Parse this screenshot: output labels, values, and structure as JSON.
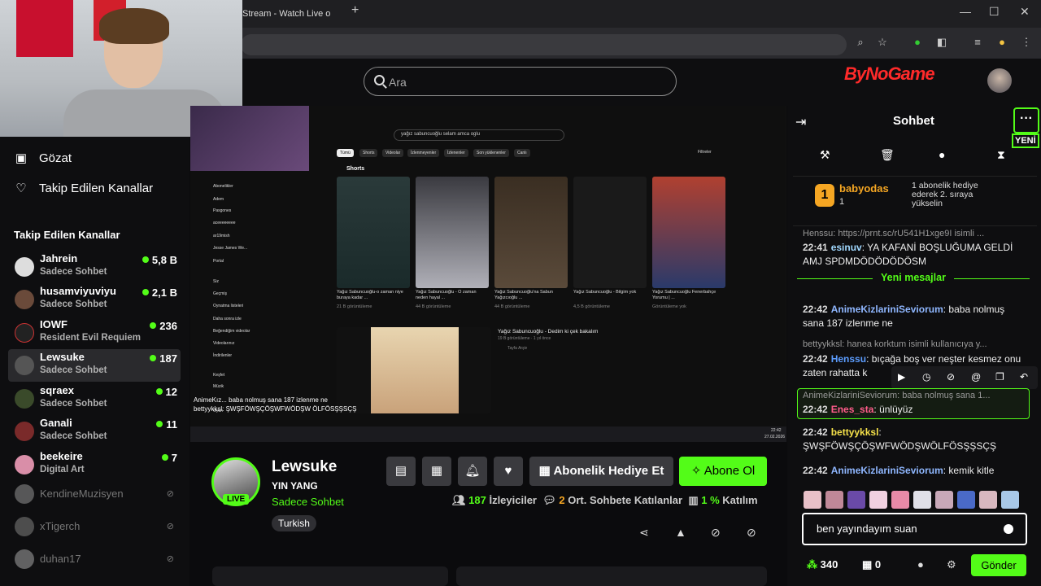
{
  "browser": {
    "tab_title": "Stream - Watch Live o",
    "new_tab": "+"
  },
  "site": {
    "search_placeholder": "Ara",
    "logo_text": "ByNoGame"
  },
  "sidebar": {
    "browse": "Gözat",
    "following_channels": "Takip Edilen Kanallar",
    "followed_header": "Takip Edilen Kanallar",
    "channels": [
      {
        "name": "Jahrein",
        "category": "Sadece Sohbet",
        "viewers": "5,8 B"
      },
      {
        "name": "husamviyuviyu",
        "category": "Sadece Sohbet",
        "viewers": "2,1 B"
      },
      {
        "name": "IOWF",
        "category": "Resident Evil Requiem",
        "viewers": "236"
      },
      {
        "name": "Lewsuke",
        "category": "Sadece Sohbet",
        "viewers": "187"
      },
      {
        "name": "sqraex",
        "category": "Sadece Sohbet",
        "viewers": "12"
      },
      {
        "name": "Ganali",
        "category": "Sadece Sohbet",
        "viewers": "11"
      },
      {
        "name": "beekeire",
        "category": "Digital Art",
        "viewers": "7"
      },
      {
        "name": "KendineMuzisyen"
      },
      {
        "name": "xTigerch"
      },
      {
        "name": "duhan17"
      }
    ]
  },
  "video": {
    "yt_search": "yağız sabuncuoğlu selam amca oglu",
    "chips": [
      "Tümü",
      "Shorts",
      "Videolar",
      "İzlenmeyenler",
      "İzlenenler",
      "Son yüklenenler",
      "Canlı"
    ],
    "filters": "Filtreler",
    "shorts_label": "Shorts",
    "menu": [
      "Abonelikler",
      "Adem",
      "Pasgones",
      "aceeeeeeee",
      "ar19mish",
      "Jesse James We...",
      "Portal",
      "Siz",
      "Geçmiş",
      "Oynatma listeleri",
      "Daha sonra izle",
      "Beğendiğim videolar",
      "Videolarınız",
      "İndirilenler",
      "Keşfet",
      "Müzik",
      "Oyun"
    ],
    "thumbs": [
      {
        "cap": "Yağız Sabuncuoğlu-o zaman niye buraya kadar ...",
        "views": "21 B görüntüleme"
      },
      {
        "cap": "Yağız Sabuncuoğlu - O zaman neden hayal ...",
        "views": "44 B görüntüleme"
      },
      {
        "cap": "Yağız Sabuncuoğlu'na Sabun Yağızcıoğlu ...",
        "views": "44 B görüntüleme"
      },
      {
        "cap": "Yağız Sabuncuoğlu - Bilgim yok",
        "views": "4,5 B görüntüleme"
      },
      {
        "cap": "Yağız Sabuncuoğlu Fenerbahçe Yorumu | ...",
        "views": "Görüntüleme yok"
      }
    ],
    "video_title": "Yağız Sabuncuoğlu - Dedim ki çek bakalım",
    "video_meta": "19 B görüntüleme · 1 yıl önce",
    "video_channel": "Tayfa Arşiv",
    "overlay_chat": [
      "AnimeKız... baba nolmuş sana 187 izlenme ne",
      "bettyykksl: ŞWŞFÖWŞÇÖŞWFWÖDŞW ÖLFÖSŞŞSÇŞ"
    ],
    "clock": "22:42",
    "date": "27.02.2026"
  },
  "channel": {
    "name": "Lewsuke",
    "title": "YIN YANG",
    "category": "Sadece Sohbet",
    "language": "Turkish",
    "live": "LIVE",
    "gift_label": "Abonelik Hediye Et",
    "subscribe_label": "Abone Ol",
    "viewers_num": "187",
    "viewers_label": "İzleyiciler",
    "chatters_num": "2",
    "chatters_label": "Ort. Sohbete Katılanlar",
    "participation_num": "1 %",
    "participation_label": "Katılım"
  },
  "chat": {
    "title": "Sohbet",
    "new_badge": "YENİ",
    "pinned": {
      "user": "babyodas",
      "subs": "1",
      "desc": "1 abonelik hediye ederek 2. sıraya yükselin"
    },
    "messages": [
      {
        "reply": "Henssu: https://prnt.sc/rU541H1xge9I isimli ..."
      },
      {
        "time": "22:41",
        "user": "esinuv",
        "color": "#a0d8ff",
        "text": "YA KAFANİ BOŞLUĞUMA GELDİ AMJ SPDMDÖDÖDÖDÖSM"
      },
      {
        "time": "22:42",
        "user": "AnimeKizlariniSeviorum",
        "color": "#8fb7ff",
        "text": "baba nolmuş sana 187 izlenme ne"
      },
      {
        "reply": "bettyykksl: hanea korktum isimli kullanıcıya y..."
      },
      {
        "time": "22:42",
        "user": "Henssu",
        "color": "#5c9dff",
        "text": "bıçağa boş ver neşter kesmez onu zaten rahatta k"
      },
      {
        "reply": "AnimeKizlariniSeviorum: baba nolmuş sana 1..."
      },
      {
        "time": "22:42",
        "user": "Enes_sta",
        "color": "#ff5c8a",
        "text": "ünlüyüz"
      },
      {
        "time": "22:42",
        "user": "bettyykksl",
        "color": "#f5e14a",
        "text": "ŞWŞFÖWŞÇÖŞWFWÖDŞWÖLFÖSŞŞSÇŞ"
      },
      {
        "time": "22:42",
        "user": "AnimeKizlariniSeviorum",
        "color": "#8fb7ff",
        "text": "kemik kitle"
      }
    ],
    "new_messages": "Yeni mesajlar",
    "input_value": "ben yayındayım suan",
    "points": "340",
    "points2": "0",
    "send": "Gönder"
  }
}
